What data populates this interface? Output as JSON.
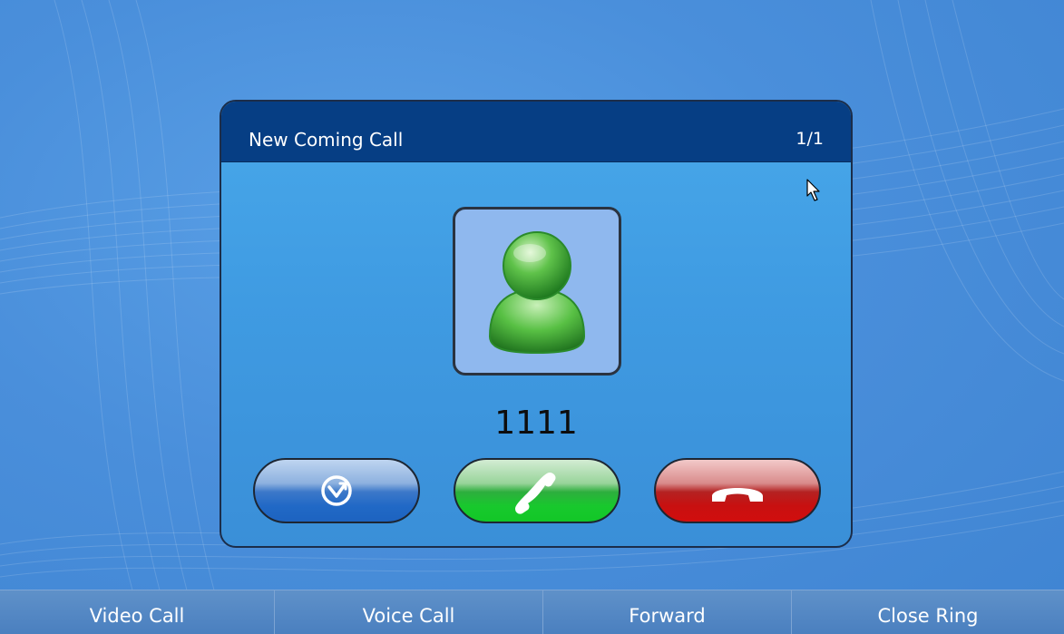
{
  "dialog": {
    "title": "New Coming Call",
    "counter": "1/1",
    "caller_number": "1111",
    "avatar_icon": "contact-person-icon",
    "buttons": [
      {
        "icon": "forward-icon",
        "color": "#2169c6"
      },
      {
        "icon": "answer-phone-icon",
        "color": "#18c82d"
      },
      {
        "icon": "hang-up-icon",
        "color": "#c81010"
      }
    ]
  },
  "softkeys": {
    "video_call": "Video Call",
    "voice_call": "Voice Call",
    "forward": "Forward",
    "close_ring": "Close Ring"
  },
  "colors": {
    "background": "#4a8fdb",
    "header": "#063e84",
    "dialog_body": "#48a8ea",
    "bottom_bar": "#4a7fbf"
  }
}
